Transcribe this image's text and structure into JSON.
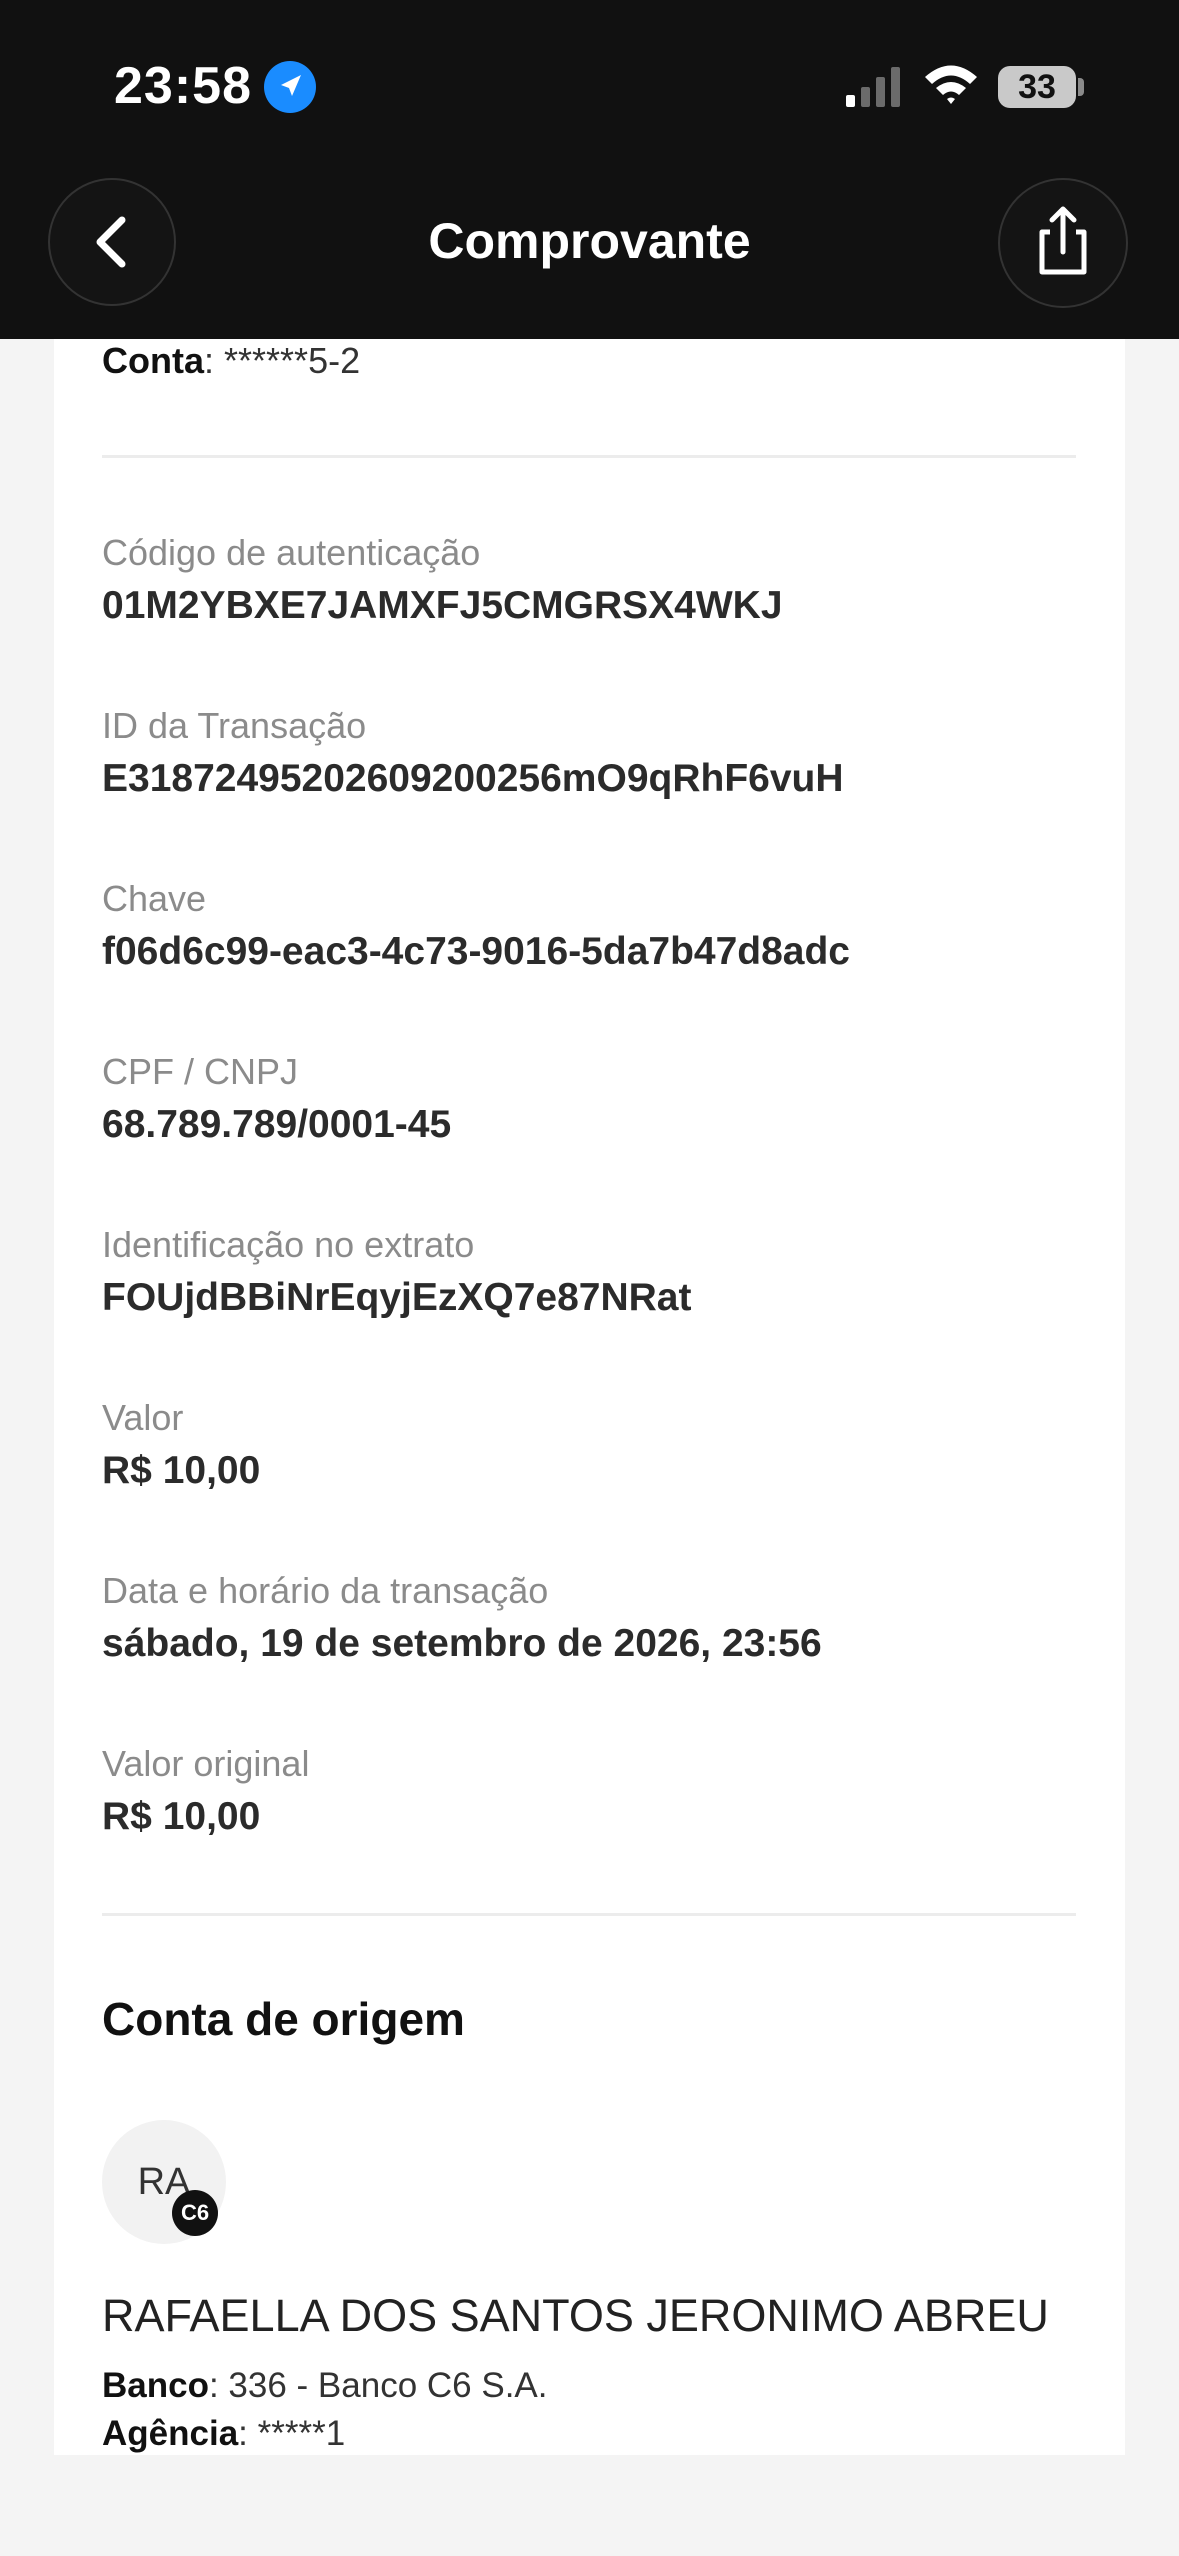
{
  "status_bar": {
    "time": "23:58",
    "battery": "33"
  },
  "header": {
    "title": "Comprovante"
  },
  "top_partial": {
    "conta_label": "Conta",
    "conta_value": ": ******5-2"
  },
  "rows": [
    {
      "label": "Código de autenticação",
      "value": "01M2YBXE7JAMXFJ5CMGRSX4WKJ"
    },
    {
      "label": "ID da Transação",
      "value": "E31872495202609200256mO9qRhF6vuH"
    },
    {
      "label": "Chave",
      "value": "f06d6c99-eac3-4c73-9016-5da7b47d8adc"
    },
    {
      "label": "CPF / CNPJ",
      "value": "68.789.789/0001-45"
    },
    {
      "label": "Identificação no extrato",
      "value": "FOUjdBBiNrEqyjEzXQ7e87NRat"
    },
    {
      "label": "Valor",
      "value": "R$ 10,00"
    },
    {
      "label": "Data e horário da transação",
      "value": "sábado, 19 de setembro de 2026, 23:56"
    },
    {
      "label": "Valor original",
      "value": "R$ 10,00"
    }
  ],
  "origin": {
    "section_title": "Conta de origem",
    "avatar_initials": "RA",
    "bank_badge": "C6",
    "name": "RAFAELLA DOS SANTOS JERONIMO ABREU",
    "banco_label": "Banco",
    "banco_value": ": 336 - Banco C6 S.A.",
    "agencia_label": "Agência",
    "agencia_value": ": *****1"
  },
  "colors": {
    "header_bg": "#111111",
    "location_blue": "#1a8cff",
    "page_bg": "#f4f4f4"
  },
  "icons": [
    "location-arrow-icon",
    "cellular-signal-icon",
    "wifi-icon",
    "chevron-left-icon",
    "share-icon"
  ]
}
